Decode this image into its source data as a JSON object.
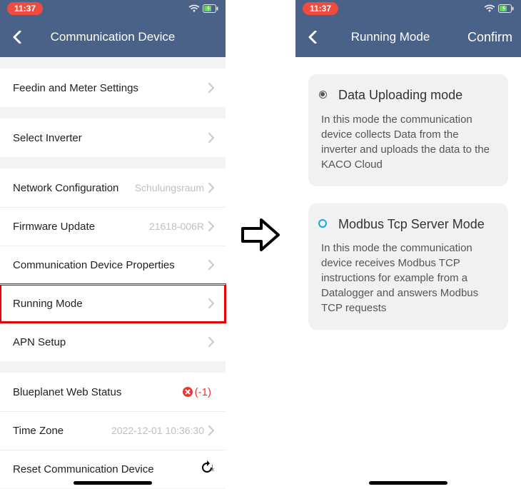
{
  "status": {
    "time": "11:37"
  },
  "left": {
    "title": "Communication Device",
    "rows": {
      "feedin": "Feedin and Meter Settings",
      "select_inverter": "Select Inverter",
      "network_cfg": "Network Configuration",
      "network_cfg_val": "Schulungsraum",
      "firmware": "Firmware Update",
      "firmware_val": "21618-006R",
      "cd_props": "Communication Device Properties",
      "running_mode": "Running Mode",
      "apn": "APN Setup",
      "web_status": "Blueplanet Web Status",
      "web_status_val": "(-1)",
      "timezone": "Time Zone",
      "timezone_val": "2022-12-01 10:36:30",
      "reset": "Reset Communication Device"
    }
  },
  "right": {
    "title": "Running Mode",
    "confirm": "Confirm",
    "modes": [
      {
        "title": "Data Uploading mode",
        "desc": "In this mode the communication device collects Data from the inverter and uploads the data to the KACO Cloud",
        "selected": true
      },
      {
        "title": "Modbus Tcp Server Mode",
        "desc": "In this mode the communication device receives Modbus TCP instructions for example from a Datalogger and answers Modbus TCP requests",
        "selected": false
      }
    ]
  }
}
